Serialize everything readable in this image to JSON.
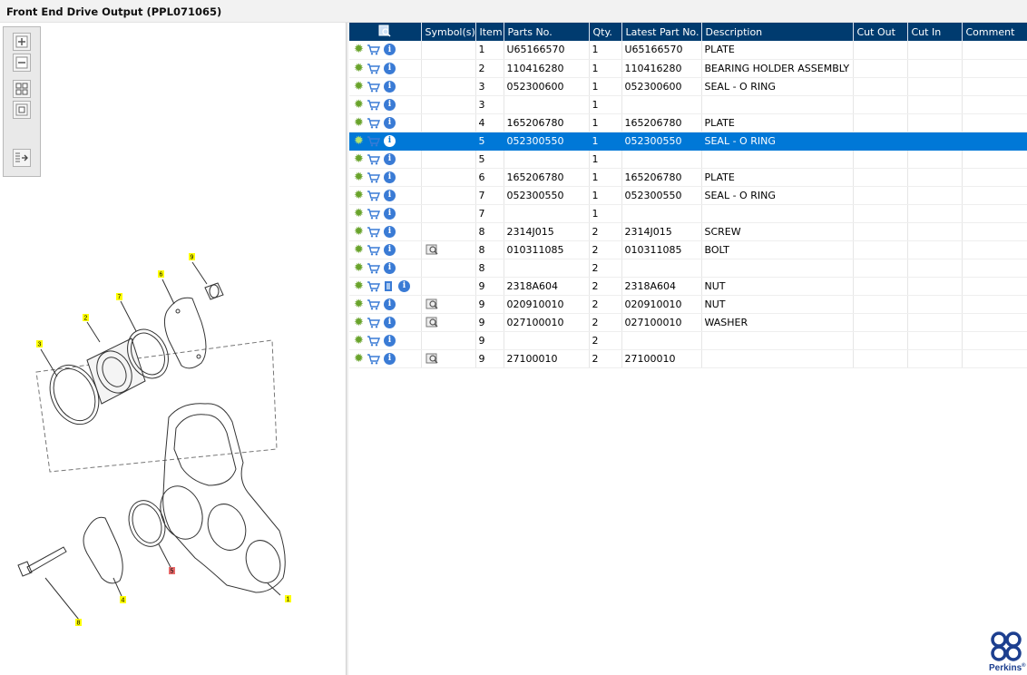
{
  "window": {
    "title": "Front End Drive Output (PPL071065)"
  },
  "toolbox": {
    "zoom_in": "zoom-in-icon",
    "zoom_out": "zoom-out-icon",
    "fit_all": "fit-all-icon",
    "fit_window": "fit-window-icon",
    "export": "export-list-icon"
  },
  "drawing": {
    "callouts": [
      "1",
      "2",
      "3",
      "4",
      "5",
      "6",
      "7",
      "8",
      "9"
    ],
    "highlighted_callout": "5",
    "callout_color": "#ffff00",
    "highlight_color": "#e86a6a"
  },
  "table": {
    "columns": [
      "",
      "Symbol(s)",
      "Item",
      "Parts No.",
      "Qty.",
      "Latest Part No.",
      "Description",
      "Cut Out",
      "Cut In",
      "Comment"
    ],
    "header_color": "#003b6f",
    "selected_color": "#0078d7",
    "rows": [
      {
        "item": "1",
        "part": "U65166570",
        "qty": "1",
        "latest": "U65166570",
        "desc": "PLATE",
        "symbol": "",
        "extra": ""
      },
      {
        "item": "2",
        "part": "110416280",
        "qty": "1",
        "latest": "110416280",
        "desc": "BEARING HOLDER ASSEMBLY",
        "symbol": "",
        "extra": ""
      },
      {
        "item": "3",
        "part": "052300600",
        "qty": "1",
        "latest": "052300600",
        "desc": "SEAL - O RING",
        "symbol": "",
        "extra": ""
      },
      {
        "item": "3",
        "part": "",
        "qty": "1",
        "latest": "",
        "desc": "",
        "symbol": "",
        "extra": ""
      },
      {
        "item": "4",
        "part": "165206780",
        "qty": "1",
        "latest": "165206780",
        "desc": "PLATE",
        "symbol": "",
        "extra": ""
      },
      {
        "item": "5",
        "part": "052300550",
        "qty": "1",
        "latest": "052300550",
        "desc": "SEAL - O RING",
        "symbol": "",
        "extra": "",
        "selected": true
      },
      {
        "item": "5",
        "part": "",
        "qty": "1",
        "latest": "",
        "desc": "",
        "symbol": "",
        "extra": ""
      },
      {
        "item": "6",
        "part": "165206780",
        "qty": "1",
        "latest": "165206780",
        "desc": "PLATE",
        "symbol": "",
        "extra": ""
      },
      {
        "item": "7",
        "part": "052300550",
        "qty": "1",
        "latest": "052300550",
        "desc": "SEAL - O RING",
        "symbol": "",
        "extra": ""
      },
      {
        "item": "7",
        "part": "",
        "qty": "1",
        "latest": "",
        "desc": "",
        "symbol": "",
        "extra": ""
      },
      {
        "item": "8",
        "part": "2314J015",
        "qty": "2",
        "latest": "2314J015",
        "desc": "SCREW",
        "symbol": "",
        "extra": ""
      },
      {
        "item": "8",
        "part": "010311085",
        "qty": "2",
        "latest": "010311085",
        "desc": "BOLT",
        "symbol": "view",
        "extra": ""
      },
      {
        "item": "8",
        "part": "",
        "qty": "2",
        "latest": "",
        "desc": "",
        "symbol": "",
        "extra": ""
      },
      {
        "item": "9",
        "part": "2318A604",
        "qty": "2",
        "latest": "2318A604",
        "desc": "NUT",
        "symbol": "",
        "extra": "book"
      },
      {
        "item": "9",
        "part": "020910010",
        "qty": "2",
        "latest": "020910010",
        "desc": "NUT",
        "symbol": "view",
        "extra": ""
      },
      {
        "item": "9",
        "part": "027100010",
        "qty": "2",
        "latest": "027100010",
        "desc": "WASHER",
        "symbol": "view",
        "extra": ""
      },
      {
        "item": "9",
        "part": "",
        "qty": "2",
        "latest": "",
        "desc": "",
        "symbol": "",
        "extra": ""
      },
      {
        "item": "9",
        "part": "27100010",
        "qty": "2",
        "latest": "27100010",
        "desc": "",
        "symbol": "view",
        "extra": ""
      }
    ]
  },
  "logo": {
    "text": "Perkins",
    "symbol": "®",
    "color": "#1d3f8f"
  }
}
